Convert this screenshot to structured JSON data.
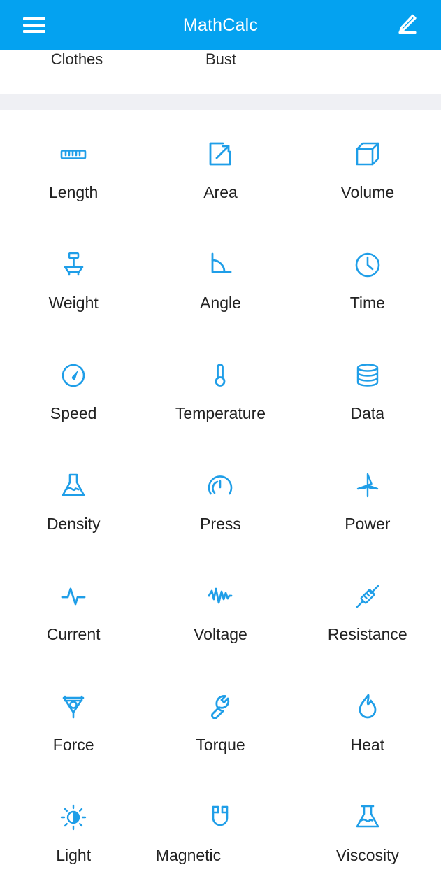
{
  "header": {
    "title": "MathCalc",
    "menu_icon": "hamburger-menu-icon",
    "edit_icon": "pencil-edit-icon",
    "background_color": "#04a2f0",
    "text_color": "#ffffff"
  },
  "partial_row": {
    "note": "partially scrolled-off row from the previous category group",
    "items": [
      {
        "label": "Clothes"
      },
      {
        "label": "Bust"
      }
    ]
  },
  "theme": {
    "accent_color": "#1f9ee8",
    "icon_color": "#1f9ee8",
    "label_color": "#222222",
    "divider_color": "#eff0f4",
    "page_background": "#ffffff"
  },
  "grid": {
    "columns": 3,
    "rows": [
      [
        {
          "label": "Length",
          "icon": "ruler-icon"
        },
        {
          "label": "Area",
          "icon": "area-expand-icon"
        },
        {
          "label": "Volume",
          "icon": "cube-wireframe-icon"
        }
      ],
      [
        {
          "label": "Weight",
          "icon": "platform-scale-icon"
        },
        {
          "label": "Angle",
          "icon": "angle-arc-icon"
        },
        {
          "label": "Time",
          "icon": "clock-icon"
        }
      ],
      [
        {
          "label": "Speed",
          "icon": "speedometer-icon"
        },
        {
          "label": "Temperature",
          "icon": "thermometer-icon"
        },
        {
          "label": "Data",
          "icon": "database-cylinder-icon"
        }
      ],
      [
        {
          "label": "Density",
          "icon": "flask-liquid-icon"
        },
        {
          "label": "Press",
          "icon": "pressure-gauge-icon"
        },
        {
          "label": "Power",
          "icon": "wind-turbine-icon"
        }
      ],
      [
        {
          "label": "Current",
          "icon": "current-waveform-icon"
        },
        {
          "label": "Voltage",
          "icon": "voltage-zigzag-icon"
        },
        {
          "label": "Resistance",
          "icon": "resistor-icon"
        }
      ],
      [
        {
          "label": "Force",
          "icon": "pulley-load-icon"
        },
        {
          "label": "Torque",
          "icon": "wrench-icon"
        },
        {
          "label": "Heat",
          "icon": "flame-icon"
        }
      ],
      [
        {
          "label": "Light",
          "icon": "brightness-sun-icon"
        },
        {
          "label": "Magnetic",
          "icon": "horseshoe-magnet-icon"
        },
        {
          "label": "Viscosity",
          "icon": "flask-icon"
        }
      ]
    ]
  }
}
